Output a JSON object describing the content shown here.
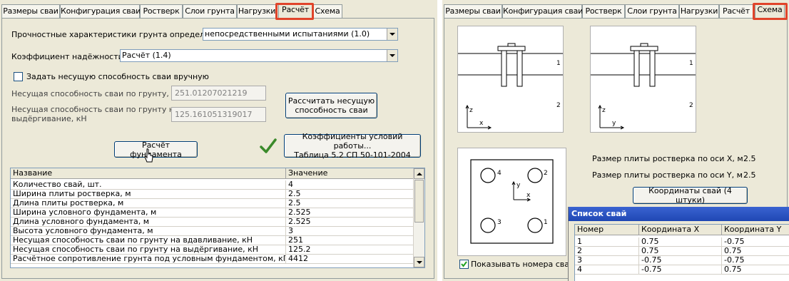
{
  "left": {
    "tabs": [
      "Размеры сваи",
      "Конфигурация сваи",
      "Ростверк",
      "Слои грунта",
      "Нагрузки",
      "Расчёт",
      "Схема"
    ],
    "active_tab": "Расчёт",
    "strength_label": "Прочностные характеристики грунта определены",
    "strength_value": "непосредственными испытаниями (1.0)",
    "reliability_label": "Коэффициент надёжности",
    "reliability_value": "Расчёт (1.4)",
    "manual_checkbox_label": "Задать несущую способность сваи вручную",
    "bearing_label": "Несущая способность сваи по грунту, кН",
    "bearing_value": "251.01207021219",
    "pullout_label_1": "Несущая способность сваи по грунту на",
    "pullout_label_2": "выдёргивание, кН",
    "pullout_value": "125.161051319017",
    "calc_capacity_btn_1": "Рассчитать несущую",
    "calc_capacity_btn_2": "способность сваи",
    "calc_foundation_btn": "Расчёт фундамента",
    "coef_btn_1": "Коэффициенты условий работы...",
    "coef_btn_2": "Таблица 5.2 СП 50-101-2004",
    "table": {
      "columns": [
        "Название",
        "Значение"
      ],
      "rows": [
        [
          "Количество свай, шт.",
          "4"
        ],
        [
          "Ширина плиты ростверка, м",
          "2.5"
        ],
        [
          "Длина плиты ростверка, м",
          "2.5"
        ],
        [
          "Ширина условного фундамента, м",
          "2.525"
        ],
        [
          "Длина условного фундамента, м",
          "2.525"
        ],
        [
          "Высота условного фундамента, м",
          "3"
        ],
        [
          "Несущая способность сваи по грунту на вдавливание, кН",
          "251"
        ],
        [
          "Несущая способность сваи по грунту на выдёргивание, кН",
          "125.2"
        ],
        [
          "Расчётное сопротивление грунта под условным фундаментом, кПа",
          "4412"
        ]
      ]
    }
  },
  "right": {
    "tabs": [
      "Размеры сваи",
      "Конфигурация сваи",
      "Ростверк",
      "Слои грунта",
      "Нагрузки",
      "Расчёт",
      "Схема"
    ],
    "active_tab": "Схема",
    "section_xz": {
      "layer1": "1",
      "layer2": "2",
      "axis_v": "z",
      "axis_h": "x"
    },
    "section_yz": {
      "layer1": "1",
      "layer2": "2",
      "axis_v": "z",
      "axis_h": "y"
    },
    "plan": {
      "pile_labels": [
        "1",
        "2",
        "3",
        "4"
      ],
      "axis_x": "x",
      "axis_y": "y"
    },
    "plate_x_label": "Размер плиты ростверка по оси X, м",
    "plate_x_value": "2.5",
    "plate_y_label": "Размер плиты ростверка по оси Y, м",
    "plate_y_value": "2.5",
    "coords_btn": "Координаты свай (4 штуки)",
    "show_numbers_label": "Показывать номера свай",
    "show_numbers_checked": true,
    "pile_list": {
      "title": "Список свай",
      "columns": [
        "Номер",
        "Координата X",
        "Координата Y"
      ],
      "rows": [
        [
          "1",
          "0.75",
          "-0.75"
        ],
        [
          "2",
          "0.75",
          "0.75"
        ],
        [
          "3",
          "-0.75",
          "-0.75"
        ],
        [
          "4",
          "-0.75",
          "0.75"
        ]
      ]
    }
  },
  "colors": {
    "highlight": "#e0442a",
    "window_bg": "#ece9d8",
    "checkmark": "#3a8a2a",
    "title_bar": "#1f47b4"
  }
}
